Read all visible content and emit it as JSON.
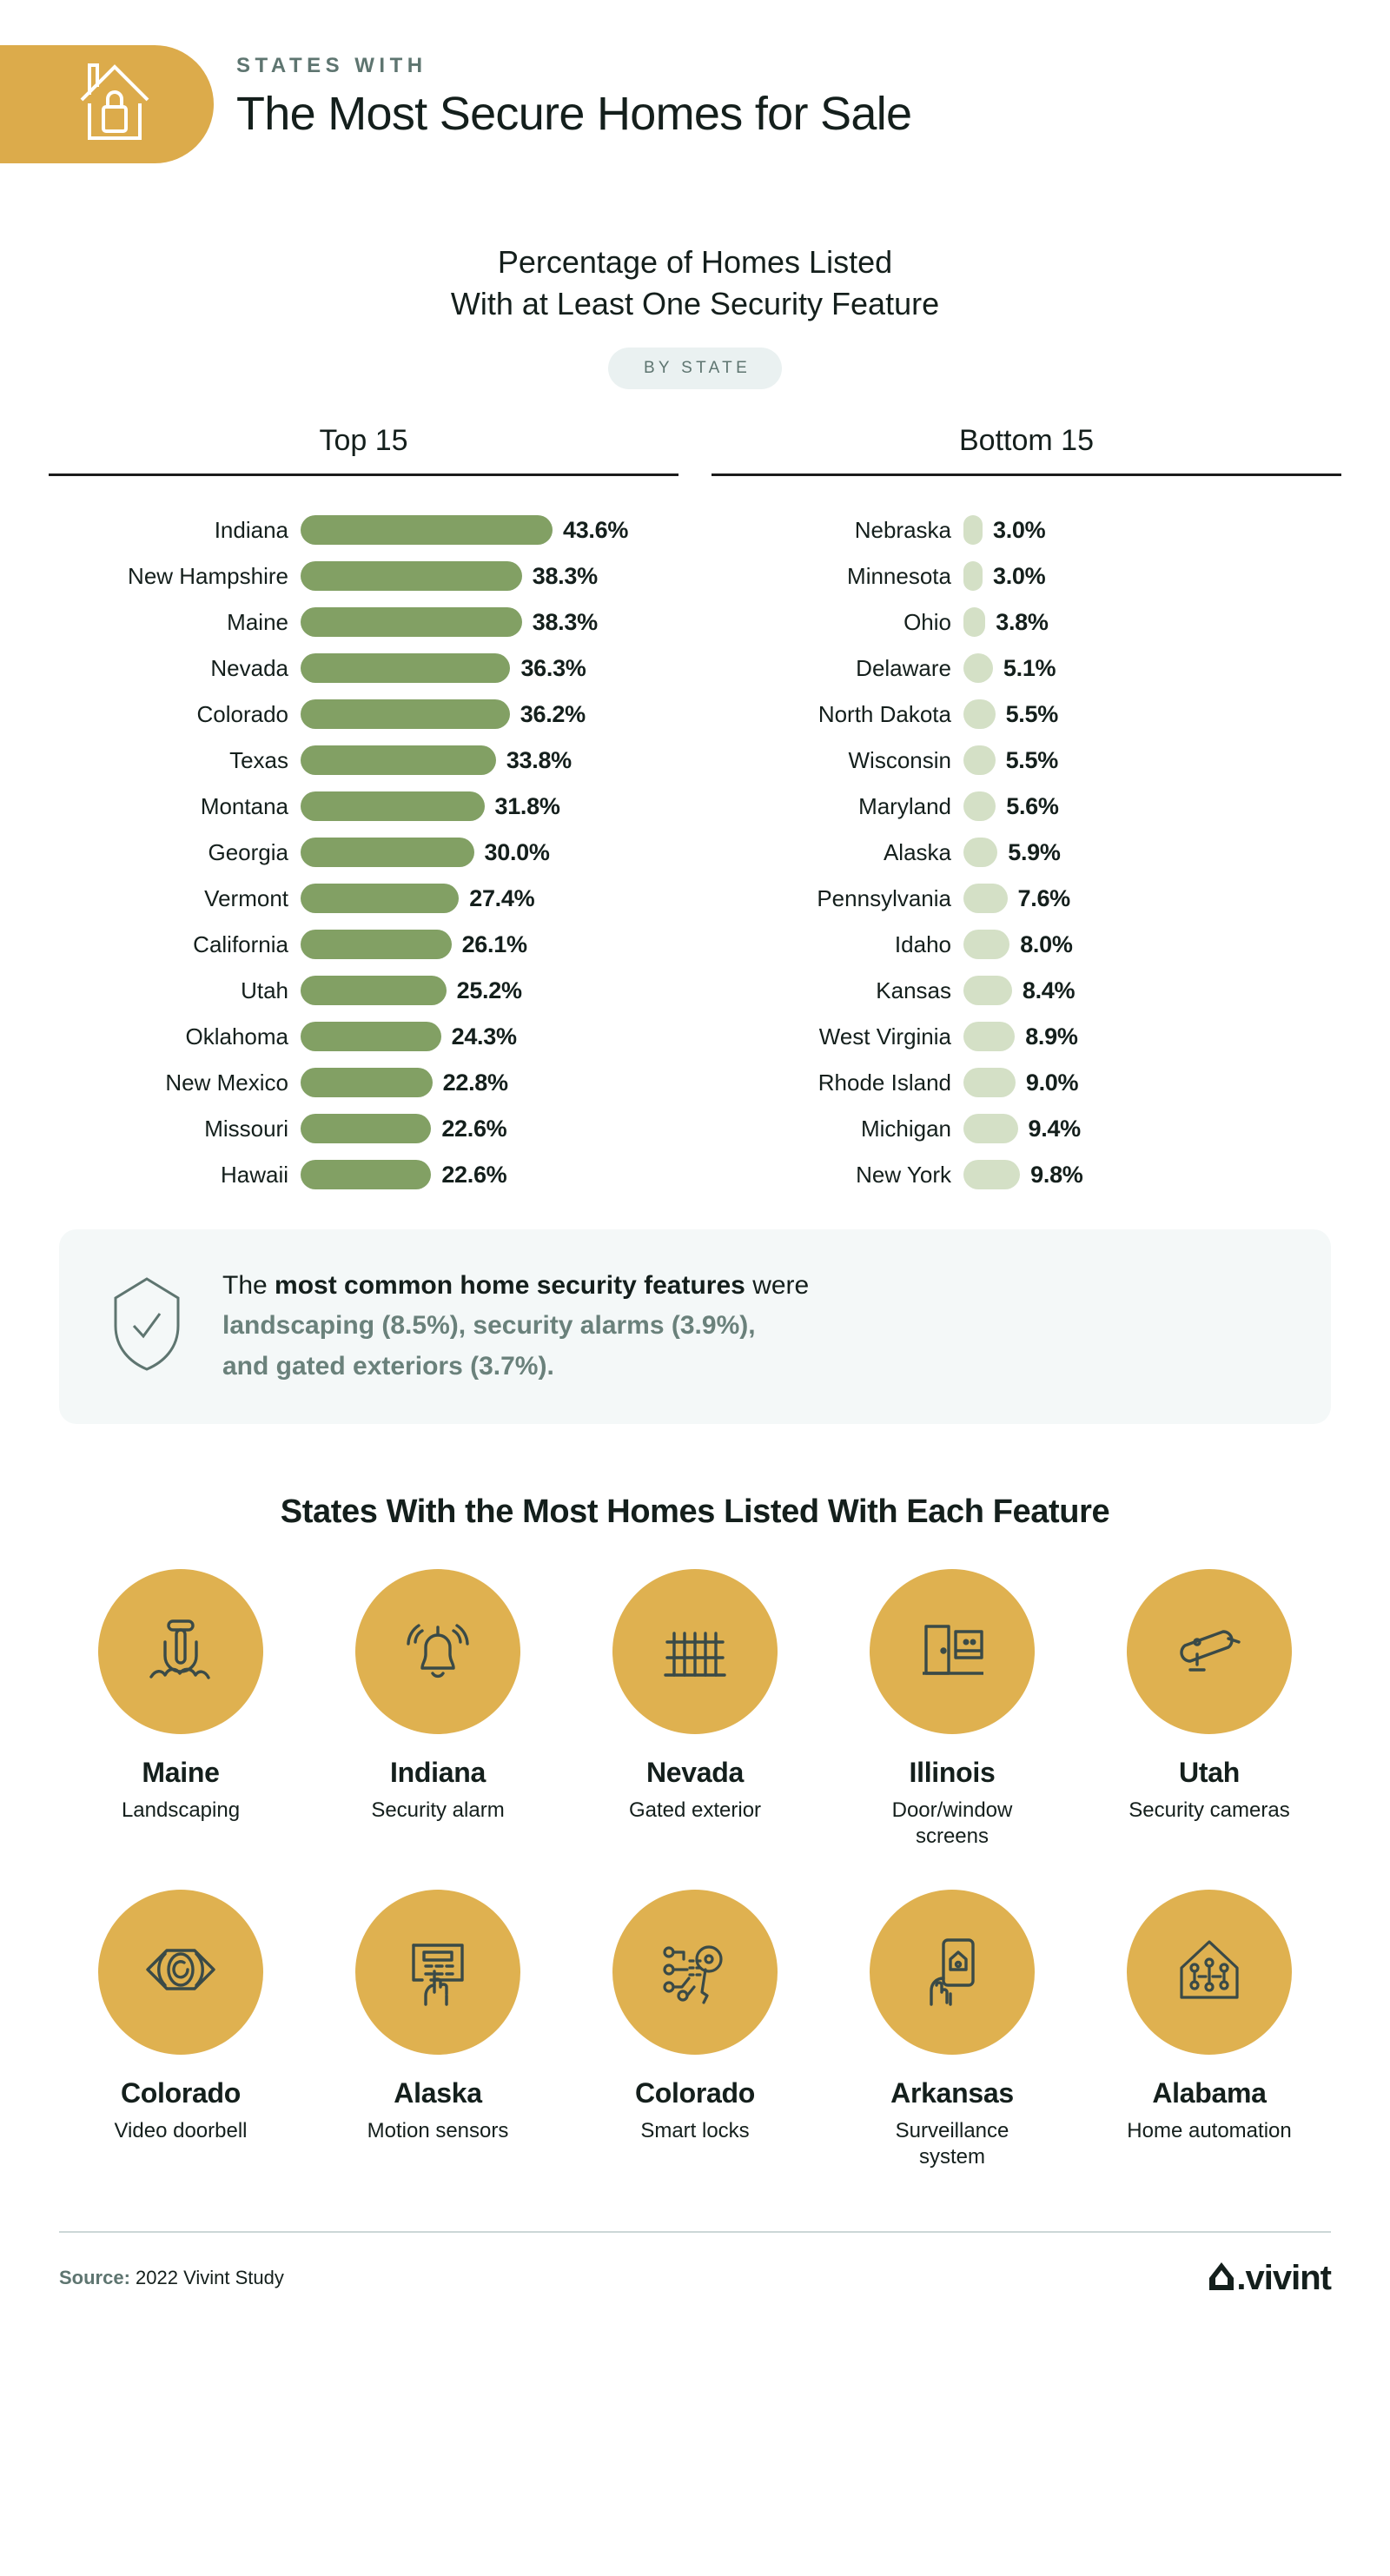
{
  "header": {
    "eyebrow": "STATES WITH",
    "title": "The Most Secure Homes for Sale",
    "icon": "house-lock-icon",
    "pill_color": "#dcab4b"
  },
  "subtitle": {
    "line1": "Percentage of Homes Listed",
    "line2": "With at Least One Security Feature",
    "badge": "BY STATE"
  },
  "chart_data": {
    "type": "bar",
    "title": "Percentage of Homes Listed With at Least One Security Feature",
    "subtitle": "BY STATE",
    "xlabel": "",
    "ylabel": "",
    "orientation": "horizontal",
    "grid": false,
    "legend": "none",
    "value_suffix": "%",
    "xlim": [
      0,
      43.6
    ],
    "panels": [
      {
        "name": "Top 15",
        "bar_color": "#82a064",
        "categories": [
          "Indiana",
          "New Hampshire",
          "Maine",
          "Nevada",
          "Colorado",
          "Texas",
          "Montana",
          "Georgia",
          "Vermont",
          "California",
          "Utah",
          "Oklahoma",
          "New Mexico",
          "Missouri",
          "Hawaii"
        ],
        "values": [
          43.6,
          38.3,
          38.3,
          36.3,
          36.2,
          33.8,
          31.8,
          30.0,
          27.4,
          26.1,
          25.2,
          24.3,
          22.8,
          22.6,
          22.6
        ],
        "labels": [
          "43.6%",
          "38.3%",
          "38.3%",
          "36.3%",
          "36.2%",
          "33.8%",
          "31.8%",
          "30.0%",
          "27.4%",
          "26.1%",
          "25.2%",
          "24.3%",
          "22.8%",
          "22.6%",
          "22.6%"
        ]
      },
      {
        "name": "Bottom 15",
        "bar_color": "#d4e0c6",
        "categories": [
          "Nebraska",
          "Minnesota",
          "Ohio",
          "Delaware",
          "North Dakota",
          "Wisconsin",
          "Maryland",
          "Alaska",
          "Pennsylvania",
          "Idaho",
          "Kansas",
          "West Virginia",
          "Rhode Island",
          "Michigan",
          "New York"
        ],
        "values": [
          3.0,
          3.0,
          3.8,
          5.1,
          5.5,
          5.5,
          5.6,
          5.9,
          7.6,
          8.0,
          8.4,
          8.9,
          9.0,
          9.4,
          9.8
        ],
        "labels": [
          "3.0%",
          "3.0%",
          "3.8%",
          "5.1%",
          "5.5%",
          "5.5%",
          "5.6%",
          "5.9%",
          "7.6%",
          "8.0%",
          "8.4%",
          "8.9%",
          "9.0%",
          "9.4%",
          "9.8%"
        ]
      }
    ]
  },
  "callout": {
    "icon": "shield-check-icon",
    "lead_before": "The ",
    "lead_bold": "most common home security features",
    "lead_after": " were",
    "highlight_line1": "landscaping (8.5%), security alarms (3.9%),",
    "highlight_line2": "and gated exteriors (3.7%)."
  },
  "features": {
    "title": "States With the Most Homes Listed With Each Feature",
    "items": [
      {
        "state": "Maine",
        "feature": "Landscaping",
        "icon": "shovel-icon"
      },
      {
        "state": "Indiana",
        "feature": "Security alarm",
        "icon": "alarm-bell-icon"
      },
      {
        "state": "Nevada",
        "feature": "Gated exterior",
        "icon": "gate-fence-icon"
      },
      {
        "state": "Illinois",
        "feature": "Door/window screens",
        "icon": "door-window-icon"
      },
      {
        "state": "Utah",
        "feature": "Security cameras",
        "icon": "security-camera-icon"
      },
      {
        "state": "Colorado",
        "feature": "Video doorbell",
        "icon": "eye-icon"
      },
      {
        "state": "Alaska",
        "feature": "Motion sensors",
        "icon": "keypad-hand-icon"
      },
      {
        "state": "Colorado",
        "feature": "Smart locks",
        "icon": "smart-lock-icon"
      },
      {
        "state": "Arkansas",
        "feature": "Surveillance system",
        "icon": "phone-hand-icon"
      },
      {
        "state": "Alabama",
        "feature": "Home automation",
        "icon": "smart-home-icon"
      }
    ]
  },
  "footer": {
    "source_label": "Source:",
    "source_text": " 2022 Vivint Study",
    "logo_text": "vivint",
    "logo_icon": "vivint-house-icon"
  }
}
